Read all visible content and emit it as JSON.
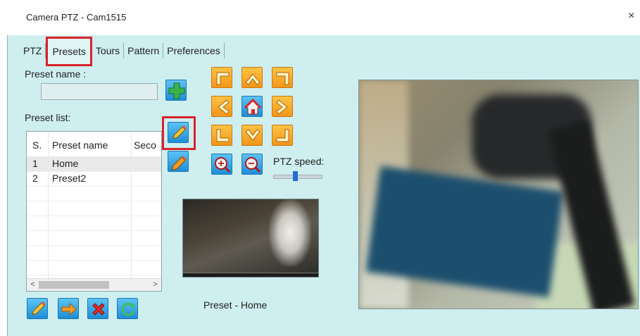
{
  "window": {
    "title": "Camera PTZ - Cam1515",
    "close_glyph": "×"
  },
  "tabs": [
    {
      "label": "PTZ"
    },
    {
      "label": "Presets",
      "active": true
    },
    {
      "label": "Tours"
    },
    {
      "label": "Pattern"
    },
    {
      "label": "Preferences"
    }
  ],
  "preset_form": {
    "name_label": "Preset name :",
    "name_value": "",
    "list_label": "Preset list:"
  },
  "preset_table": {
    "columns": [
      "S.",
      "Preset name",
      "Seco"
    ],
    "rows": [
      {
        "s": "1",
        "name": "Home",
        "selected": true
      },
      {
        "s": "2",
        "name": "Preset2",
        "selected": false
      }
    ],
    "scroll_left": "<",
    "scroll_right": ">"
  },
  "ptz": {
    "speed_label": "PTZ speed:",
    "speed_value": 0.45
  },
  "preview_caption": "Preset - Home",
  "icons": {
    "add": "plus-icon",
    "edit": "pencil-icon",
    "update": "pencil-edit-icon",
    "goto": "arrow-right-icon",
    "delete": "red-x-icon",
    "refresh": "refresh-icon",
    "home": "home-icon",
    "zoom_in": "zoom-in-icon",
    "zoom_out": "zoom-out-icon"
  },
  "colors": {
    "accent_red": "#d9232a",
    "panel_bg": "#cfeef0",
    "button_orange": "#f39619",
    "button_blue": "#1f8ed8"
  }
}
